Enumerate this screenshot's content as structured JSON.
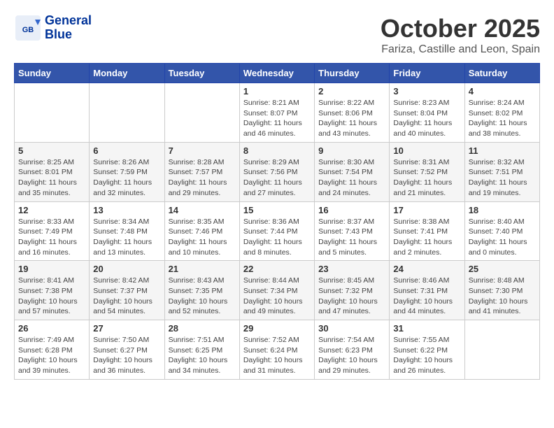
{
  "header": {
    "logo_line1": "General",
    "logo_line2": "Blue",
    "month_title": "October 2025",
    "location": "Fariza, Castille and Leon, Spain"
  },
  "weekdays": [
    "Sunday",
    "Monday",
    "Tuesday",
    "Wednesday",
    "Thursday",
    "Friday",
    "Saturday"
  ],
  "weeks": [
    [
      {
        "day": "",
        "info": ""
      },
      {
        "day": "",
        "info": ""
      },
      {
        "day": "",
        "info": ""
      },
      {
        "day": "1",
        "info": "Sunrise: 8:21 AM\nSunset: 8:07 PM\nDaylight: 11 hours\nand 46 minutes."
      },
      {
        "day": "2",
        "info": "Sunrise: 8:22 AM\nSunset: 8:06 PM\nDaylight: 11 hours\nand 43 minutes."
      },
      {
        "day": "3",
        "info": "Sunrise: 8:23 AM\nSunset: 8:04 PM\nDaylight: 11 hours\nand 40 minutes."
      },
      {
        "day": "4",
        "info": "Sunrise: 8:24 AM\nSunset: 8:02 PM\nDaylight: 11 hours\nand 38 minutes."
      }
    ],
    [
      {
        "day": "5",
        "info": "Sunrise: 8:25 AM\nSunset: 8:01 PM\nDaylight: 11 hours\nand 35 minutes."
      },
      {
        "day": "6",
        "info": "Sunrise: 8:26 AM\nSunset: 7:59 PM\nDaylight: 11 hours\nand 32 minutes."
      },
      {
        "day": "7",
        "info": "Sunrise: 8:28 AM\nSunset: 7:57 PM\nDaylight: 11 hours\nand 29 minutes."
      },
      {
        "day": "8",
        "info": "Sunrise: 8:29 AM\nSunset: 7:56 PM\nDaylight: 11 hours\nand 27 minutes."
      },
      {
        "day": "9",
        "info": "Sunrise: 8:30 AM\nSunset: 7:54 PM\nDaylight: 11 hours\nand 24 minutes."
      },
      {
        "day": "10",
        "info": "Sunrise: 8:31 AM\nSunset: 7:52 PM\nDaylight: 11 hours\nand 21 minutes."
      },
      {
        "day": "11",
        "info": "Sunrise: 8:32 AM\nSunset: 7:51 PM\nDaylight: 11 hours\nand 19 minutes."
      }
    ],
    [
      {
        "day": "12",
        "info": "Sunrise: 8:33 AM\nSunset: 7:49 PM\nDaylight: 11 hours\nand 16 minutes."
      },
      {
        "day": "13",
        "info": "Sunrise: 8:34 AM\nSunset: 7:48 PM\nDaylight: 11 hours\nand 13 minutes."
      },
      {
        "day": "14",
        "info": "Sunrise: 8:35 AM\nSunset: 7:46 PM\nDaylight: 11 hours\nand 10 minutes."
      },
      {
        "day": "15",
        "info": "Sunrise: 8:36 AM\nSunset: 7:44 PM\nDaylight: 11 hours\nand 8 minutes."
      },
      {
        "day": "16",
        "info": "Sunrise: 8:37 AM\nSunset: 7:43 PM\nDaylight: 11 hours\nand 5 minutes."
      },
      {
        "day": "17",
        "info": "Sunrise: 8:38 AM\nSunset: 7:41 PM\nDaylight: 11 hours\nand 2 minutes."
      },
      {
        "day": "18",
        "info": "Sunrise: 8:40 AM\nSunset: 7:40 PM\nDaylight: 11 hours\nand 0 minutes."
      }
    ],
    [
      {
        "day": "19",
        "info": "Sunrise: 8:41 AM\nSunset: 7:38 PM\nDaylight: 10 hours\nand 57 minutes."
      },
      {
        "day": "20",
        "info": "Sunrise: 8:42 AM\nSunset: 7:37 PM\nDaylight: 10 hours\nand 54 minutes."
      },
      {
        "day": "21",
        "info": "Sunrise: 8:43 AM\nSunset: 7:35 PM\nDaylight: 10 hours\nand 52 minutes."
      },
      {
        "day": "22",
        "info": "Sunrise: 8:44 AM\nSunset: 7:34 PM\nDaylight: 10 hours\nand 49 minutes."
      },
      {
        "day": "23",
        "info": "Sunrise: 8:45 AM\nSunset: 7:32 PM\nDaylight: 10 hours\nand 47 minutes."
      },
      {
        "day": "24",
        "info": "Sunrise: 8:46 AM\nSunset: 7:31 PM\nDaylight: 10 hours\nand 44 minutes."
      },
      {
        "day": "25",
        "info": "Sunrise: 8:48 AM\nSunset: 7:30 PM\nDaylight: 10 hours\nand 41 minutes."
      }
    ],
    [
      {
        "day": "26",
        "info": "Sunrise: 7:49 AM\nSunset: 6:28 PM\nDaylight: 10 hours\nand 39 minutes."
      },
      {
        "day": "27",
        "info": "Sunrise: 7:50 AM\nSunset: 6:27 PM\nDaylight: 10 hours\nand 36 minutes."
      },
      {
        "day": "28",
        "info": "Sunrise: 7:51 AM\nSunset: 6:25 PM\nDaylight: 10 hours\nand 34 minutes."
      },
      {
        "day": "29",
        "info": "Sunrise: 7:52 AM\nSunset: 6:24 PM\nDaylight: 10 hours\nand 31 minutes."
      },
      {
        "day": "30",
        "info": "Sunrise: 7:54 AM\nSunset: 6:23 PM\nDaylight: 10 hours\nand 29 minutes."
      },
      {
        "day": "31",
        "info": "Sunrise: 7:55 AM\nSunset: 6:22 PM\nDaylight: 10 hours\nand 26 minutes."
      },
      {
        "day": "",
        "info": ""
      }
    ]
  ]
}
